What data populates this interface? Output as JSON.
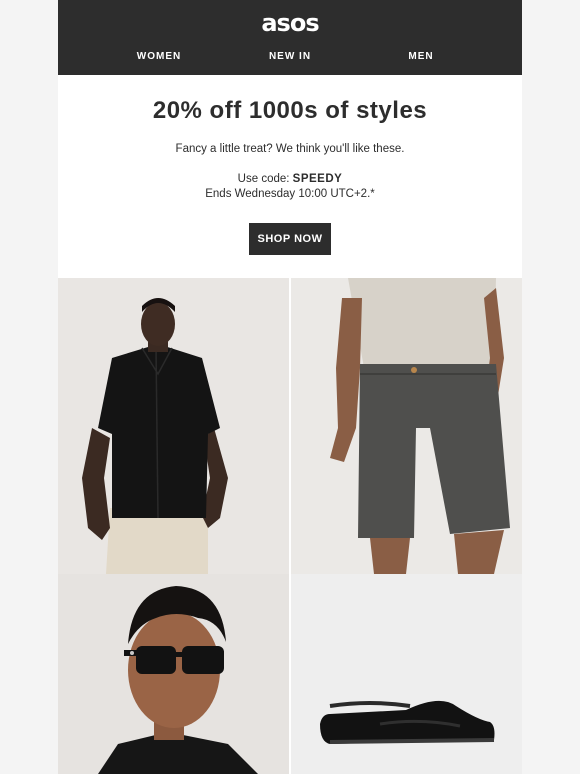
{
  "header": {
    "logo_text": "asos",
    "nav": [
      {
        "label": "WOMEN"
      },
      {
        "label": "NEW IN"
      },
      {
        "label": "MEN"
      }
    ]
  },
  "promo": {
    "title": "20% off 1000s of styles",
    "subtitle": "Fancy a little treat? We think you'll like these.",
    "code_prefix": "Use code: ",
    "code": "SPEEDY",
    "ends": "Ends Wednesday 10:00 UTC+2.*",
    "cta_label": "SHOP NOW"
  },
  "products": [
    {
      "name": "black-shirt",
      "icon": "man-black-shirt-image"
    },
    {
      "name": "grey-shorts",
      "icon": "grey-chino-shorts-image"
    },
    {
      "name": "sunglasses",
      "icon": "man-sunglasses-image"
    },
    {
      "name": "black-sneaker",
      "icon": "black-sneaker-image"
    }
  ],
  "colors": {
    "header_bg": "#2d2d2d",
    "button_bg": "#2d2d2d",
    "text": "#2d2d2d",
    "page_bg": "#f4f4f4"
  }
}
